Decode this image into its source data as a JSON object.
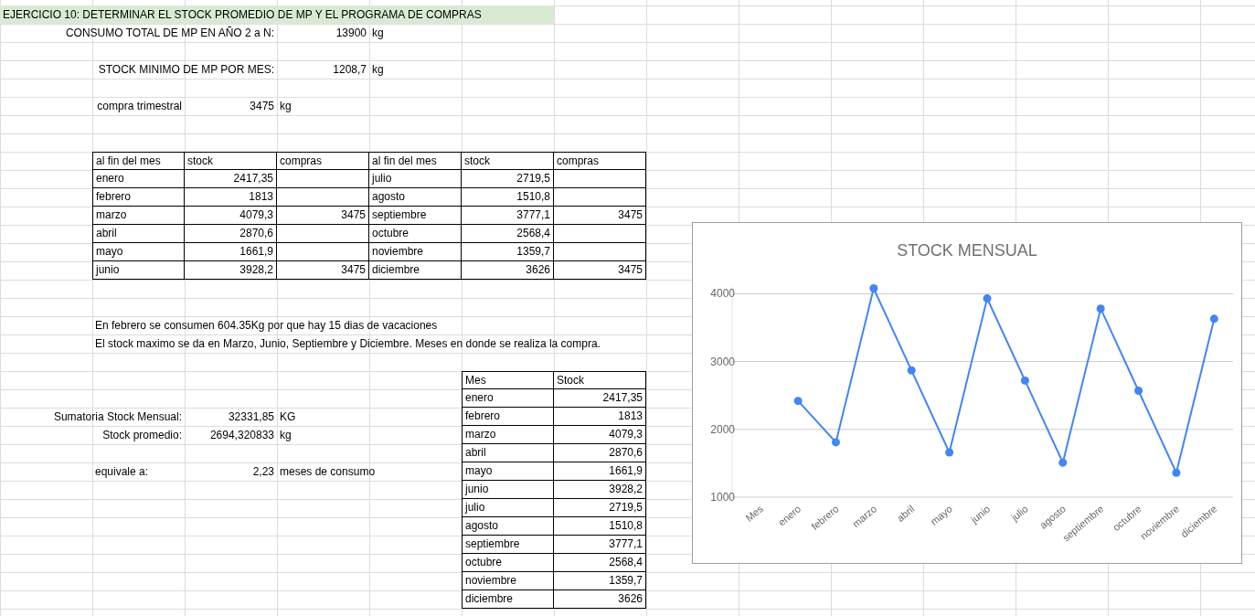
{
  "sheet": {
    "title": "EJERCICIO 10: DETERMINAR EL STOCK PROMEDIO DE MP Y EL PROGRAMA DE COMPRAS",
    "params": [
      {
        "label": "CONSUMO TOTAL DE MP EN AÑO 2 a N:",
        "value": "13900",
        "unit": "kg"
      },
      {
        "label": "STOCK MINIMO DE MP POR MES:",
        "value": "1208,7",
        "unit": "kg"
      },
      {
        "label": "compra trimestral",
        "value": "3475",
        "unit": "kg"
      }
    ],
    "stock_table": {
      "columns": [
        "al fin del mes",
        "stock",
        "compras",
        "al fin del mes",
        "stock",
        "compras"
      ],
      "rows": [
        {
          "month_1": "enero",
          "stock_1": "2417,35",
          "month_2": "julio",
          "stock_2": "2719,5"
        },
        {
          "month_1": "febrero",
          "stock_1": "1813",
          "month_2": "agosto",
          "stock_2": "1510,8"
        },
        {
          "month_1": "marzo",
          "stock_1": "4079,3",
          "compras_1": "3475",
          "month_2": "septiembre",
          "stock_2": "3777,1",
          "compras_2": "3475"
        },
        {
          "month_1": "abril",
          "stock_1": "2870,6",
          "month_2": "octubre",
          "stock_2": "2568,4"
        },
        {
          "month_1": "mayo",
          "stock_1": "1661,9",
          "month_2": "noviembre",
          "stock_2": "1359,7"
        },
        {
          "month_1": "junio",
          "stock_1": "3928,2",
          "compras_1": "3475",
          "month_2": "diciembre",
          "stock_2": "3626",
          "compras_2": "3475"
        }
      ]
    },
    "notes": [
      "En febrero se consumen 604.35Kg por que hay 15 dias de vacaciones",
      "El stock maximo se da en Marzo, Junio, Septiembre y Diciembre. Meses en donde se realiza la compra."
    ],
    "summary": [
      {
        "label": "Sumatoria Stock Mensual:",
        "value": "32331,85",
        "unit": "KG"
      },
      {
        "label": "Stock promedio:",
        "value": "2694,320833",
        "unit": "kg"
      },
      {
        "label": "equivale a:",
        "value": "2,23",
        "unit": "meses de consumo"
      }
    ],
    "monthly_table": {
      "columns": [
        "Mes",
        "Stock"
      ],
      "rows": [
        [
          "enero",
          "2417,35"
        ],
        [
          "febrero",
          "1813"
        ],
        [
          "marzo",
          "4079,3"
        ],
        [
          "abril",
          "2870,6"
        ],
        [
          "mayo",
          "1661,9"
        ],
        [
          "junio",
          "3928,2"
        ],
        [
          "julio",
          "2719,5"
        ],
        [
          "agosto",
          "1510,8"
        ],
        [
          "septiembre",
          "3777,1"
        ],
        [
          "octubre",
          "2568,4"
        ],
        [
          "noviembre",
          "1359,7"
        ],
        [
          "diciembre",
          "3626"
        ]
      ]
    },
    "chart": {
      "chart_data": {
        "type": "line",
        "title": "STOCK MENSUAL",
        "categories": [
          "Mes",
          "enero",
          "febrero",
          "marzo",
          "abril",
          "mayo",
          "junio",
          "julio",
          "agosto",
          "septiembre",
          "octubre",
          "noviembre",
          "diciembre"
        ],
        "series": [
          {
            "color": "#4285f4",
            "marker": true,
            "values": [
              null,
              2420,
              1810,
              4080,
              2870,
              1660,
              3930,
              2720,
              1510,
              3780,
              2570,
              1360,
              3630
            ]
          }
        ],
        "grid": true,
        "ylim": [
          1000,
          4100
        ],
        "yticks": [
          1000,
          2000,
          3000,
          4000
        ]
      }
    }
  }
}
